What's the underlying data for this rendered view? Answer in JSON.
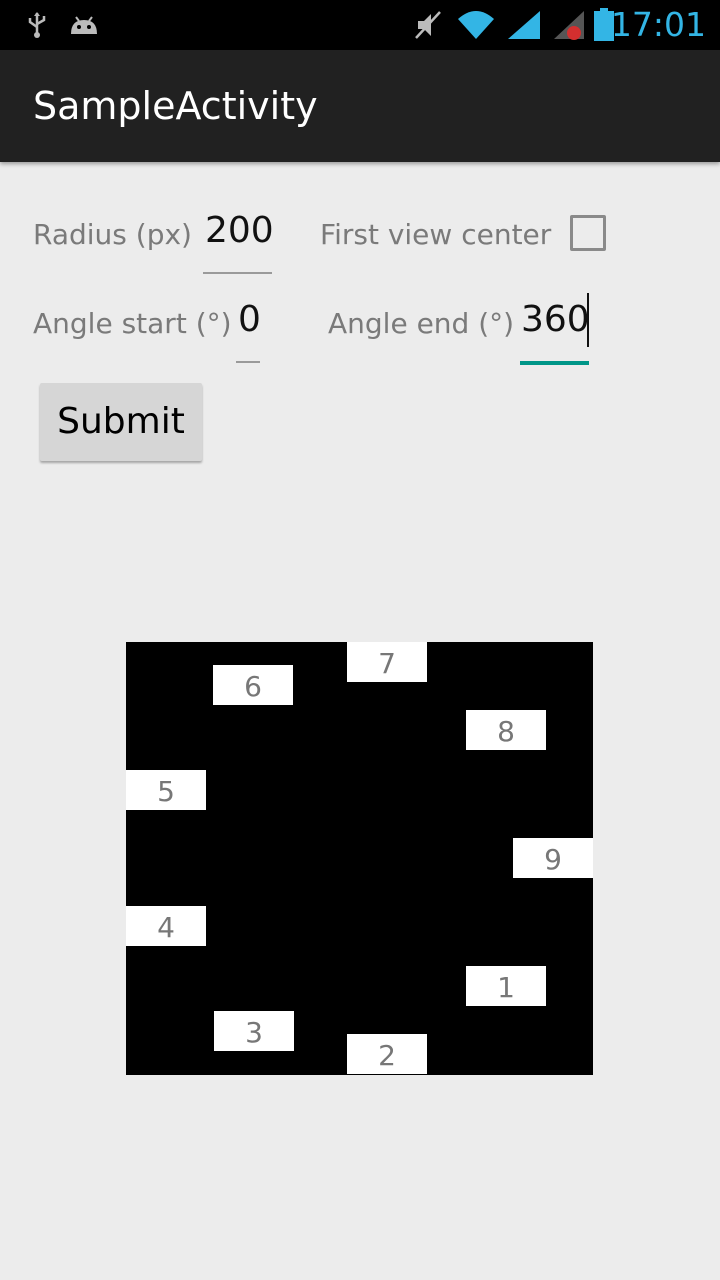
{
  "status_bar": {
    "time": "17:01",
    "left_icons": [
      "usb-icon",
      "android-debug-icon"
    ],
    "right_icons": [
      "mute-icon",
      "wifi-icon",
      "signal-icon",
      "signal-no-service-icon",
      "battery-icon"
    ],
    "accent_color": "#33b5e5"
  },
  "action_bar": {
    "title": "SampleActivity"
  },
  "form": {
    "radius_label": "Radius (px)",
    "radius_value": "200",
    "first_view_center_label": "First view center",
    "first_view_center_checked": false,
    "angle_start_label": "Angle start (°)",
    "angle_start_value": "0",
    "angle_end_label": "Angle end (°)",
    "angle_end_value": "360",
    "submit_label": "Submit",
    "focus_color": "#009688"
  },
  "circle_layout": {
    "items": [
      "1",
      "2",
      "3",
      "4",
      "5",
      "6",
      "7",
      "8",
      "9"
    ]
  }
}
